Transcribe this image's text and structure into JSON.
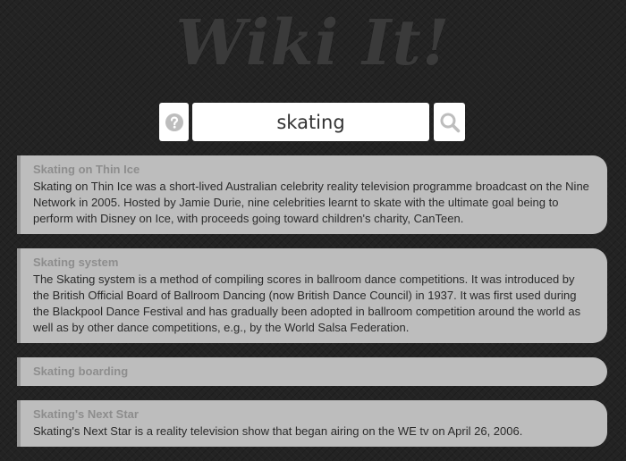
{
  "logo": {
    "text": "Wiki It!"
  },
  "search": {
    "value": "skating",
    "help_icon": "question-circle-icon",
    "search_icon": "magnifier-icon"
  },
  "results": [
    {
      "title": "Skating on Thin Ice",
      "snippet": "Skating on Thin Ice was a short-lived Australian celebrity reality television programme broadcast on the Nine Network in 2005. Hosted by Jamie Durie, nine celebrities learnt to skate with the ultimate goal being to perform with Disney on Ice, with proceeds going toward children's charity, CanTeen."
    },
    {
      "title": "Skating system",
      "snippet": "The Skating system is a method of compiling scores in ballroom dance competitions. It was introduced by the British Official Board of Ballroom Dancing (now British Dance Council) in 1937. It was first used during the Blackpool Dance Festival and has gradually been adopted in ballroom competition around the world as well as by other dance competitions, e.g., by the World Salsa Federation."
    },
    {
      "title": "Skating boarding",
      "snippet": ""
    },
    {
      "title": "Skating's Next Star",
      "snippet": "Skating's Next Star is a reality television show that began airing on the WE tv on April 26, 2006."
    }
  ],
  "colors": {
    "background": "#232323",
    "card": "#bdbdbd",
    "card_accent": "#9a9a9a",
    "icon": "#bdbdbd"
  }
}
